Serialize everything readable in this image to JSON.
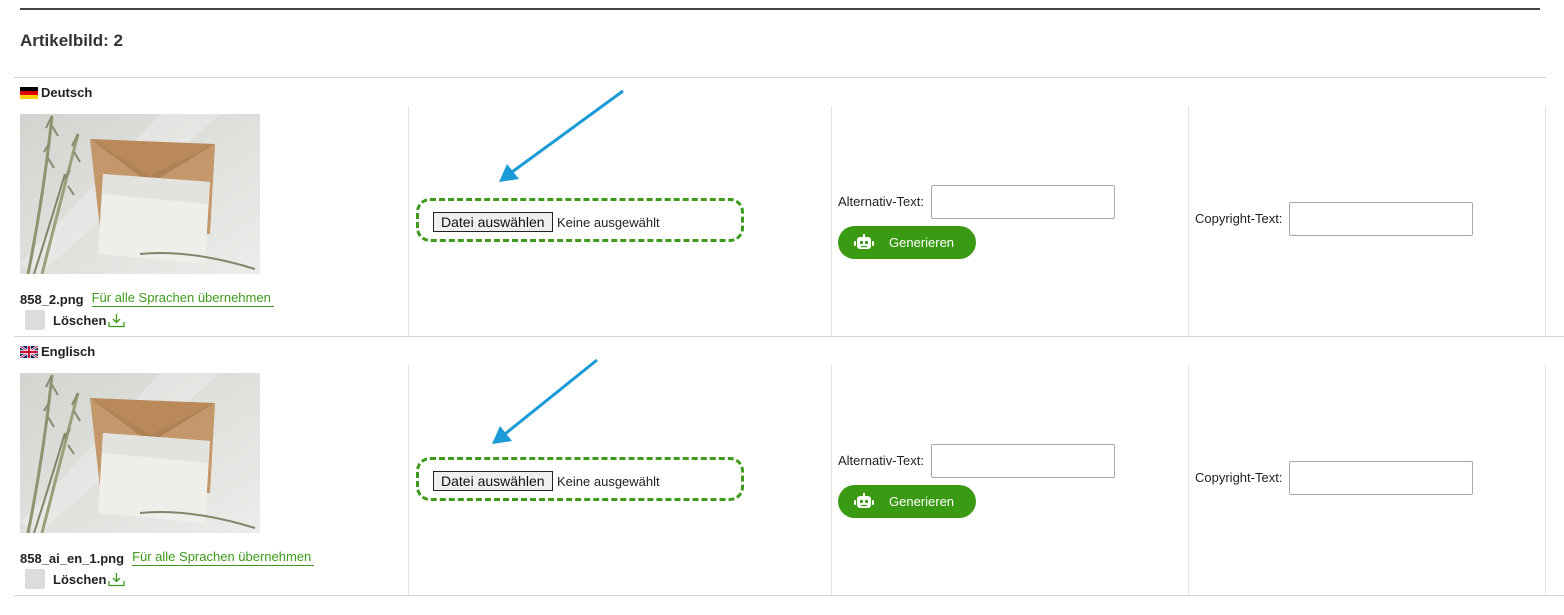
{
  "section": {
    "title": "Artikelbild: 2"
  },
  "rows": [
    {
      "language": "Deutsch",
      "flag_icon": "flag-germany-icon",
      "filename": "858_2.png",
      "apply_all_label": "Für alle Sprachen übernehmen",
      "delete_label": "Löschen",
      "file_button_label": "Datei auswählen",
      "file_status": "Keine ausgewählt",
      "alt_text_label": "Alternativ-Text:",
      "alt_text_value": "",
      "generate_label": "Generieren",
      "copyright_label": "Copyright-Text:",
      "copyright_value": ""
    },
    {
      "language": "Englisch",
      "flag_icon": "flag-uk-icon",
      "filename": "858_ai_en_1.png",
      "apply_all_label": "Für alle Sprachen übernehmen",
      "delete_label": "Löschen",
      "file_button_label": "Datei auswählen",
      "file_status": "Keine ausgewählt",
      "alt_text_label": "Alternativ-Text:",
      "alt_text_value": "",
      "generate_label": "Generieren",
      "copyright_label": "Copyright-Text:",
      "copyright_value": ""
    }
  ],
  "colors": {
    "accent_green": "#3a9a13",
    "annotation_arrow": "#1a9ad6",
    "dashed_highlight": "#3d9a1a"
  }
}
